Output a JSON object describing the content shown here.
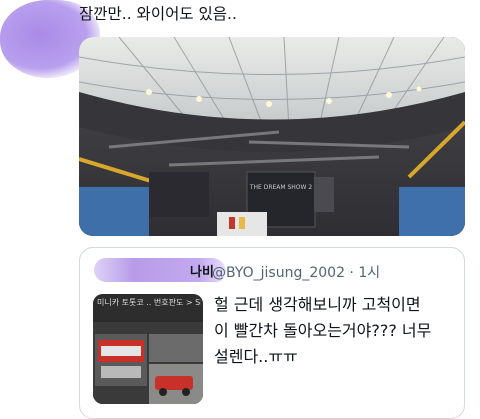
{
  "tweet": {
    "text": "잠깐만.. 와이어도 있음.."
  },
  "photo": {
    "screen_text": "THE DREAM SHOW 2"
  },
  "quote": {
    "name_visible_part": "나비",
    "handle_time": "@BYO_jisung_2002 · 1시",
    "body_line1": "헐 근데 생각해보니까 고척이면",
    "body_line2": "이 빨간차 돌아오는거야??? 너무",
    "body_line3": "설렌다..ㅠㅠ",
    "thumb_caption": "미니카 토톳코 .. 번호판도 > SHOW AR <"
  },
  "colors": {
    "redaction": "#b79be9",
    "handle": "#536471",
    "border": "#cfd9de",
    "red_car": "#c8312a"
  }
}
